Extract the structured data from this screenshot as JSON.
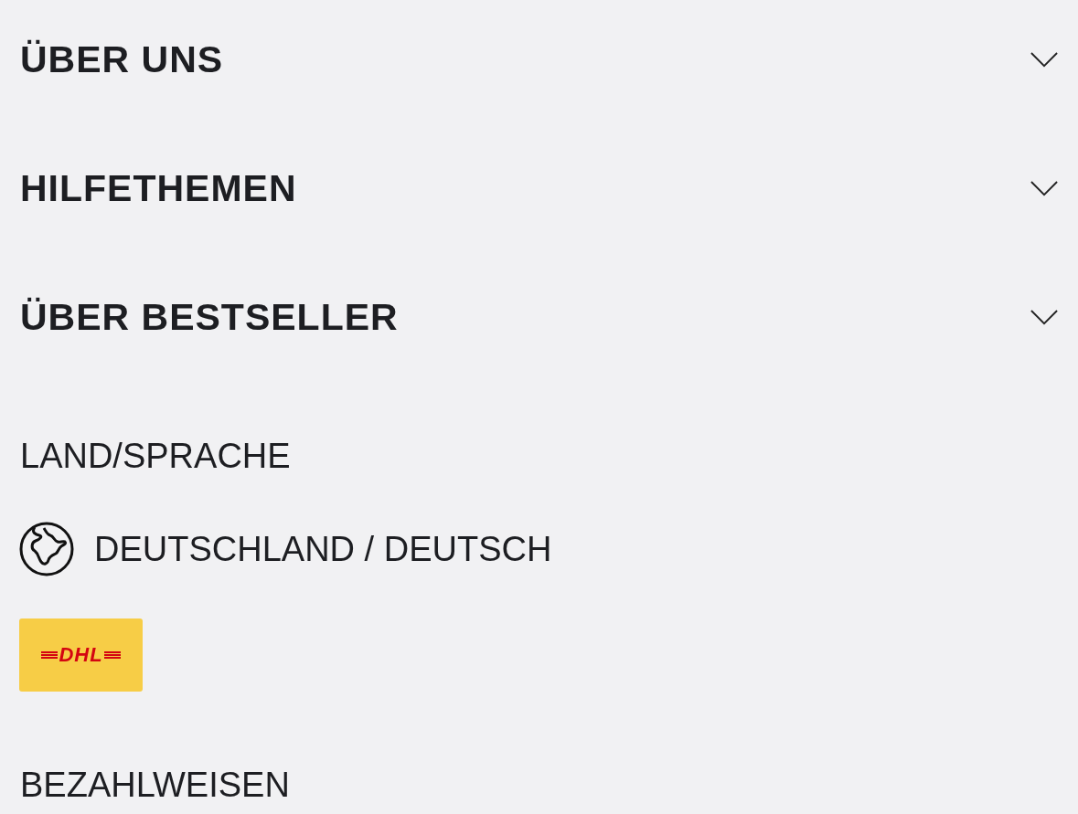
{
  "accordion": [
    {
      "title": "ÜBER UNS",
      "expanded": false
    },
    {
      "title": "HILFETHEMEN",
      "expanded": false
    },
    {
      "title": "ÜBER BESTSELLER",
      "expanded": false
    }
  ],
  "country_language": {
    "heading": "LAND/SPRACHE",
    "selection": "DEUTSCHLAND / DEUTSCH"
  },
  "shipping_logo": {
    "text": "DHL"
  },
  "payment_heading": "BEZAHLWEISEN"
}
